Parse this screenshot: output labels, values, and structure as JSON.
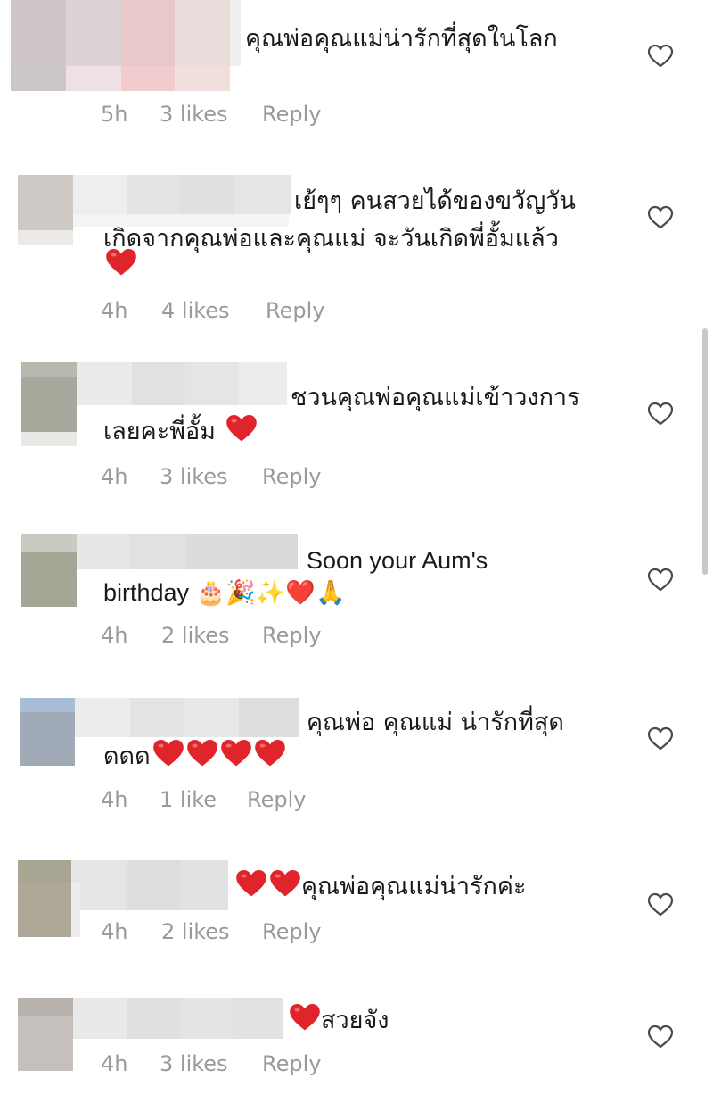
{
  "comments": [
    {
      "text_lines": [
        "คุณพ่อคุณแม่น่ารักที่สุดในโลก"
      ],
      "time": "5h",
      "likes": "3 likes",
      "reply": "Reply"
    },
    {
      "text_lines": [
        "เย้ๆๆ คนสวยได้ของขวัญวัน",
        "เกิดจากคุณพ่อและคุณแม่ จะวันเกิดพี่อั้มแล้ว",
        "❤️"
      ],
      "time": "4h",
      "likes": "4 likes",
      "reply": "Reply"
    },
    {
      "text_lines": [
        "ชวนคุณพ่อคุณแม่เข้าวงการ",
        "เลยคะพี่อั้ม ❤️"
      ],
      "time": "4h",
      "likes": "3 likes",
      "reply": "Reply"
    },
    {
      "text_lines": [
        "Soon your Aum's",
        "birthday 🎂🎉✨❤️🙏"
      ],
      "time": "4h",
      "likes": "2 likes",
      "reply": "Reply"
    },
    {
      "text_lines": [
        "คุณพ่อ คุณแม่ น่ารักที่สุด",
        "ดดด❤️❤️❤️❤️"
      ],
      "time": "4h",
      "likes": "1 like",
      "reply": "Reply"
    },
    {
      "text_lines": [
        "❤️❤️คุณพ่อคุณแม่น่ารักค่ะ"
      ],
      "time": "4h",
      "likes": "2 likes",
      "reply": "Reply"
    },
    {
      "text_lines": [
        "❤️สวยจัง"
      ],
      "time": "4h",
      "likes": "3 likes",
      "reply": "Reply"
    }
  ],
  "icons": {
    "like": "heart-outline-icon"
  },
  "colors": {
    "text": "#1a1a1a",
    "meta": "#9a9a9a",
    "heart_red": "#e0242c"
  }
}
